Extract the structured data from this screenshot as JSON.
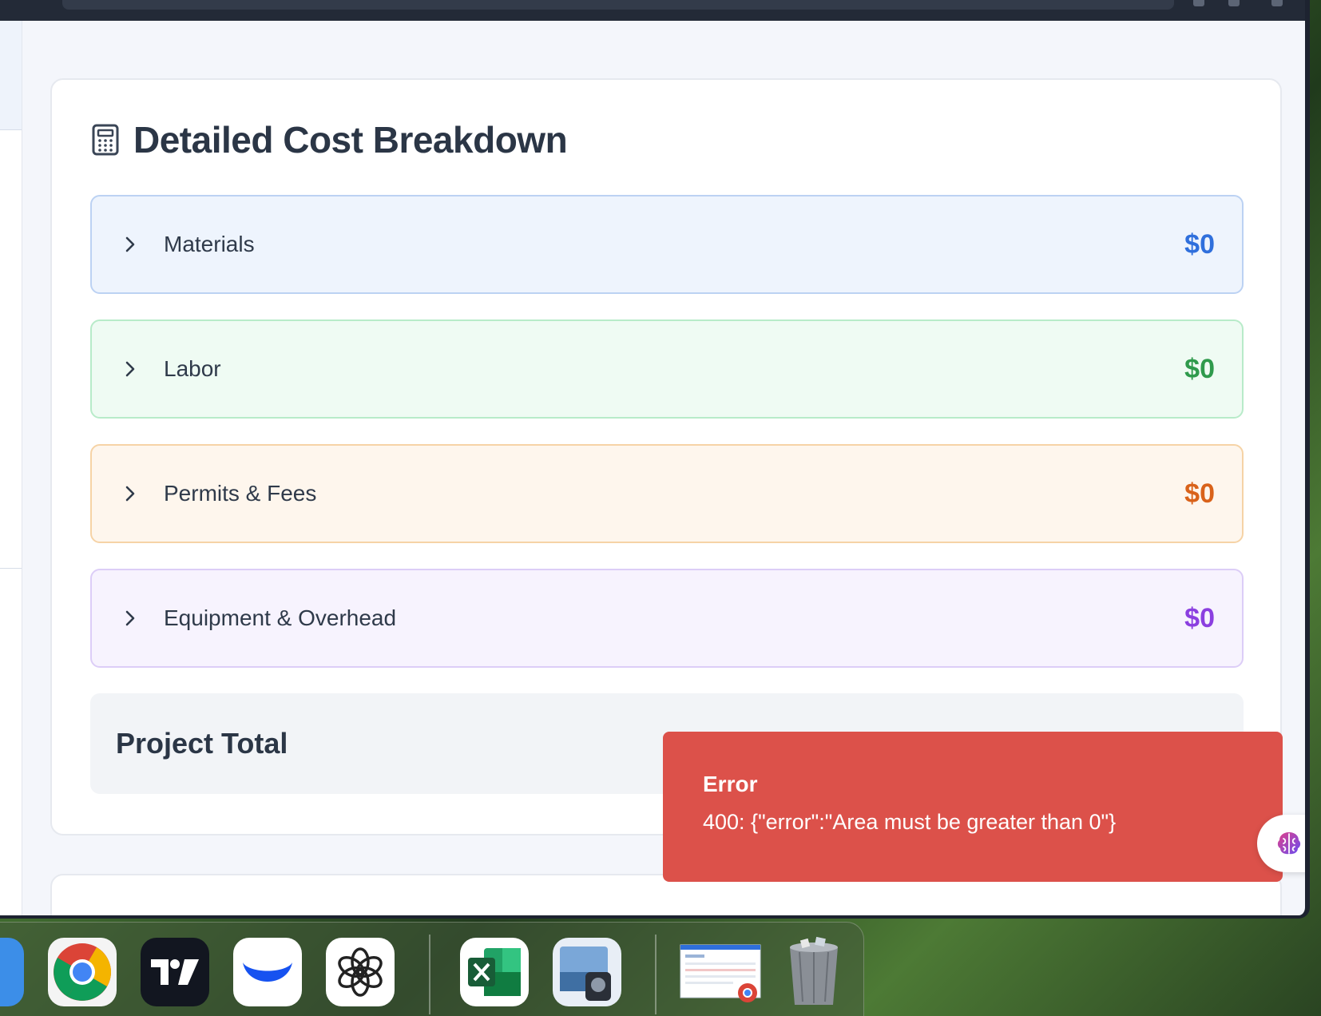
{
  "card": {
    "title": "Detailed Cost Breakdown",
    "rows": [
      {
        "label": "Materials",
        "amount": "$0",
        "color": "#2f6fdc"
      },
      {
        "label": "Labor",
        "amount": "$0",
        "color": "#2f9a4c"
      },
      {
        "label": "Permits & Fees",
        "amount": "$0",
        "color": "#d9621a"
      },
      {
        "label": "Equipment & Overhead",
        "amount": "$0",
        "color": "#8b3fe0"
      }
    ],
    "total_label": "Project Total"
  },
  "toast": {
    "title": "Error",
    "message": "400: {\"error\":\"Area must be greater than 0\"}",
    "color": "#dc514a"
  },
  "dock": {
    "apps": [
      "finder-icon",
      "chrome-icon",
      "tradingview-icon",
      "coinbase-wallet-icon",
      "chatgpt-icon",
      "excel-icon",
      "preview-icon",
      "chrome-window-thumbnail",
      "trash-icon"
    ]
  }
}
